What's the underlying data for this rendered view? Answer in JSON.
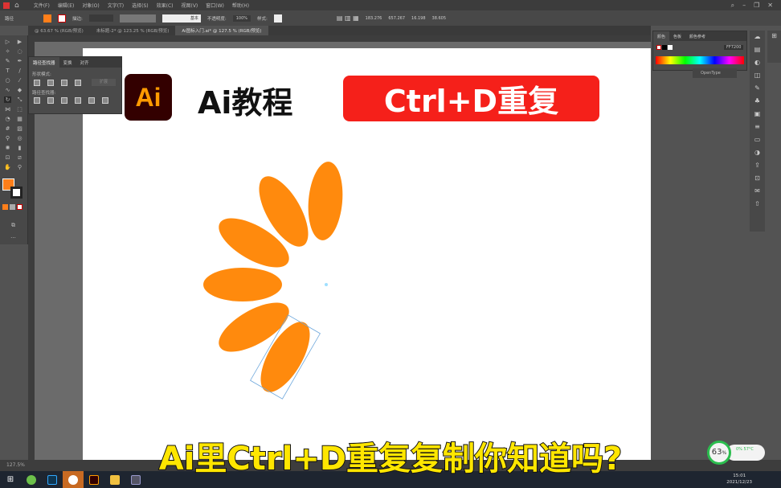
{
  "menubar": {
    "items": [
      "文件(F)",
      "编辑(E)",
      "对象(O)",
      "文字(T)",
      "选择(S)",
      "效果(C)",
      "视图(V)",
      "窗口(W)",
      "帮助(H)"
    ]
  },
  "control": {
    "path_label": "路径",
    "stroke_label": "描边:",
    "stroke_style": "基本",
    "opacity_label": "不透明度:",
    "opacity": "100%",
    "style_label": "样式:",
    "x": "183.276",
    "y": "657.267",
    "w": "16.198",
    "h": "38.605"
  },
  "tabs": [
    {
      "label": "@ 63.67 % (RGB/预览)"
    },
    {
      "label": "未标题-2* @ 123.25 % (RGB/预览)"
    },
    {
      "label": "Ai图标入门.ai* @ 127.5 % (RGB/预览)"
    }
  ],
  "pathfinder": {
    "tabs": [
      "路径查找器",
      "变换",
      "对齐"
    ],
    "shape_modes": "形状模式:",
    "pathfinders": "路径查找器:",
    "expand": "扩展"
  },
  "color_panel": {
    "tabs": [
      "颜色",
      "色板",
      "颜色参考"
    ],
    "hex": "FF7200"
  },
  "opentype": "OpenType",
  "overlay": {
    "logo": "Ai",
    "title": "Ai教程",
    "badge": "Ctrl+D重复",
    "subtitle": "Ai里Ctrl+D重复复制你知道吗?"
  },
  "colors": {
    "petal": "#ff8a0d",
    "badge": "#f5201a",
    "subtitle": "#ffe600",
    "fill": "#ff7f1a"
  },
  "status": {
    "zoom": "127.5%"
  },
  "battery": {
    "percent": "63",
    "pct_suffix": "%",
    "cpu": "0%",
    "temp": "57°C"
  },
  "clock": {
    "time": "15:01",
    "date": "2021/12/23"
  }
}
